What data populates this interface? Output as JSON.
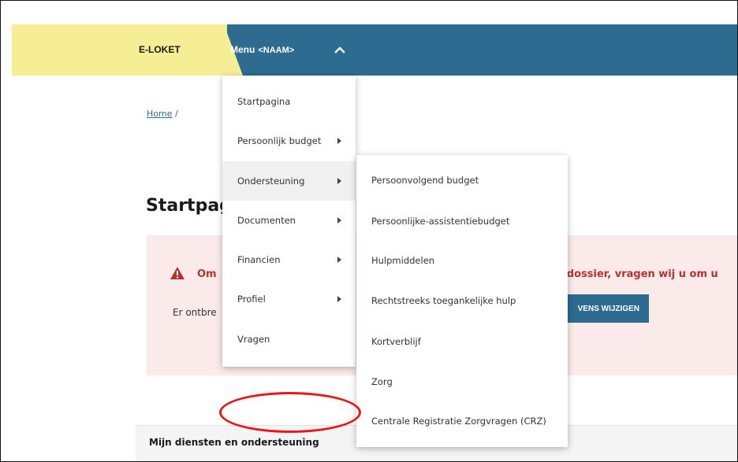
{
  "header": {
    "brand": "E-LOKET",
    "menu_label": "Menu",
    "menu_user": "<NAAM>",
    "colors": {
      "brand_bg": "#f6ee94",
      "header_bg": "#2d6b91"
    }
  },
  "breadcrumb": {
    "home": "Home",
    "separator": "/"
  },
  "page": {
    "title": "Startpag"
  },
  "alert": {
    "title_left": "Om",
    "title_right": "uw dossier, vragen wij u om u",
    "text": "Er ontbre",
    "button": "VENS WIJZIGEN",
    "colors": {
      "bg": "#fbeaea",
      "accent": "#b8312f"
    }
  },
  "services": {
    "title": "Mijn diensten en ondersteuning"
  },
  "menu_main": {
    "items": [
      {
        "label": "Startpagina",
        "has_sub": false
      },
      {
        "label": "Persoonlijk budget",
        "has_sub": true
      },
      {
        "label": "Ondersteuning",
        "has_sub": true,
        "active": true
      },
      {
        "label": "Documenten",
        "has_sub": true
      },
      {
        "label": "Financien",
        "has_sub": true
      },
      {
        "label": "Profiel",
        "has_sub": true
      },
      {
        "label": "Vragen",
        "has_sub": false
      }
    ]
  },
  "menu_sub": {
    "items": [
      {
        "label": "Persoonvolgend budget"
      },
      {
        "label": "Persoonlijke-assistentiebudget"
      },
      {
        "label": "Hulpmiddelen"
      },
      {
        "label": "Rechtstreeks toegankelijke hulp"
      },
      {
        "label": "Kortverblijf"
      },
      {
        "label": "Zorg"
      },
      {
        "label": "Centrale Registratie Zorgvragen (CRZ)"
      }
    ]
  },
  "annotation": {
    "color": "#e8151b"
  }
}
